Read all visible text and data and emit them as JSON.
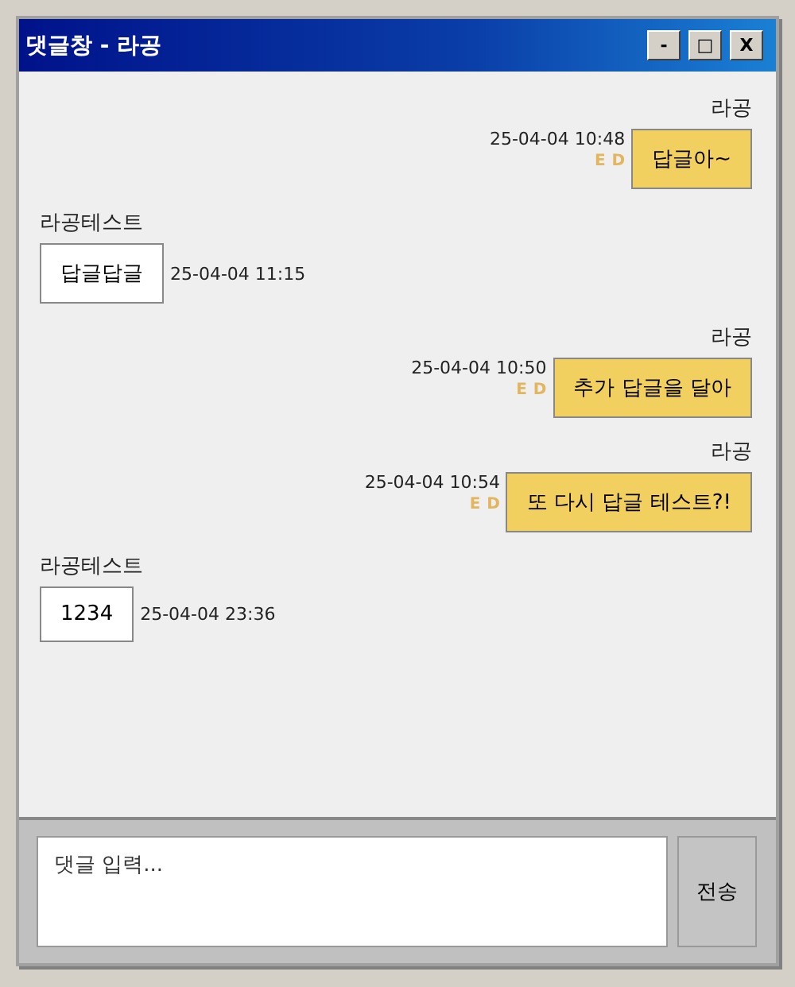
{
  "window": {
    "title": "댓글창 - 라공",
    "controls": [
      "-",
      "□",
      "X"
    ]
  },
  "messages": [
    {
      "kind": "mine",
      "author": "라공",
      "time": "25-04-04 10:48",
      "actions": [
        "E",
        "D"
      ],
      "text": "답글아~"
    },
    {
      "kind": "other",
      "author": "라공테스트",
      "time": "25-04-04 11:15",
      "text": "답글답글"
    },
    {
      "kind": "mine",
      "author": "라공",
      "time": "25-04-04 10:50",
      "actions": [
        "E",
        "D"
      ],
      "text": "추가 답글을 달아"
    },
    {
      "kind": "mine",
      "author": "라공",
      "time": "25-04-04 10:54",
      "actions": [
        "E",
        "D"
      ],
      "text": "또 다시 답글 테스트?!"
    },
    {
      "kind": "other",
      "author": "라공테스트",
      "time": "25-04-04 23:36",
      "text": "1234"
    }
  ],
  "composer": {
    "placeholder": "댓글 입력...",
    "send_button": "전송"
  }
}
